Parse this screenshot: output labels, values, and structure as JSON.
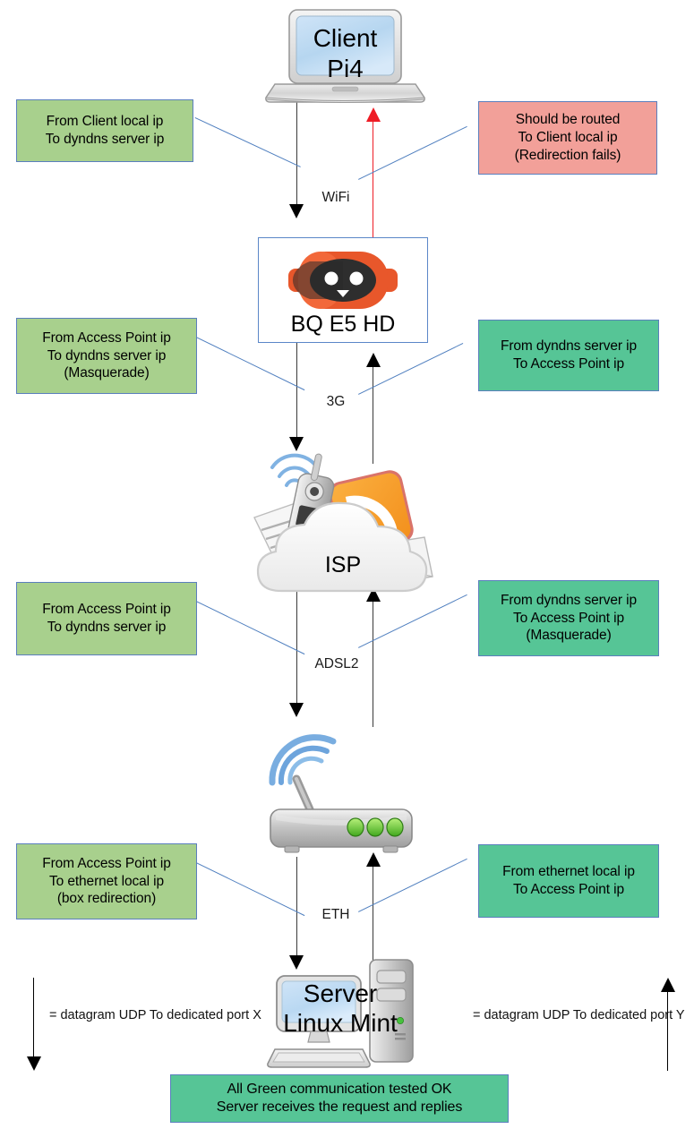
{
  "diagram": {
    "title": "Network datagram routing path diagram",
    "colors": {
      "green_left": "#a8d08d",
      "green_right": "#56c596",
      "red": "#f2a099",
      "box_border": "#5b7fbd",
      "arrow_dark": "#000000",
      "arrow_red": "#ee1c25",
      "robot_orange": "#e8572b"
    }
  },
  "nodes": [
    {
      "id": "client",
      "label_line1": "Client",
      "label_line2": "Pi4",
      "icon": "laptop-icon"
    },
    {
      "id": "bq",
      "label_line1": "BQ E5 HD",
      "label_line2": "",
      "icon": "robot-icon"
    },
    {
      "id": "isp",
      "label_line1": "ISP",
      "label_line2": "",
      "icon": "cloud-isp-icon"
    },
    {
      "id": "router",
      "label_line1": "",
      "label_line2": "",
      "icon": "wifi-router-icon"
    },
    {
      "id": "server",
      "label_line1": "Server",
      "label_line2": "Linux Mint",
      "icon": "desktop-computer-icon"
    }
  ],
  "links": [
    {
      "id": "wifi",
      "label": "WiFi"
    },
    {
      "id": "3g",
      "label": "3G"
    },
    {
      "id": "adsl2",
      "label": "ADSL2"
    },
    {
      "id": "eth",
      "label": "ETH"
    }
  ],
  "notes_left": [
    {
      "id": "note-client-out",
      "color": "green_left",
      "lines": [
        "From Client local ip",
        "To dyndns server ip"
      ]
    },
    {
      "id": "note-bq-out",
      "color": "green_left",
      "lines": [
        "From Access Point ip",
        "To dyndns server ip",
        "(Masquerade)"
      ]
    },
    {
      "id": "note-isp-out",
      "color": "green_left",
      "lines": [
        "From Access Point ip",
        "To dyndns server ip"
      ]
    },
    {
      "id": "note-router-out",
      "color": "green_left",
      "lines": [
        "From Access Point ip",
        "To ethernet local ip",
        "(box redirection)"
      ]
    }
  ],
  "notes_right": [
    {
      "id": "note-client-in",
      "color": "red",
      "lines": [
        "Should be routed",
        "To Client local ip",
        "(Redirection fails)"
      ]
    },
    {
      "id": "note-bq-in",
      "color": "green_right",
      "lines": [
        "From dyndns server ip",
        "To Access Point ip"
      ]
    },
    {
      "id": "note-isp-in",
      "color": "green_right",
      "lines": [
        "From dyndns server ip",
        "To Access Point ip",
        "(Masquerade)"
      ]
    },
    {
      "id": "note-router-in",
      "color": "green_right",
      "lines": [
        "From ethernet local ip",
        "To Access Point ip"
      ]
    }
  ],
  "legend": {
    "left": {
      "lines": [
        "= datagram UDP",
        "To dedicated port X"
      ],
      "direction": "down"
    },
    "right": {
      "lines": [
        "= datagram UDP",
        "To dedicated port Y"
      ],
      "direction": "up"
    }
  },
  "footer_note": {
    "color": "green_right",
    "lines": [
      "All Green communication tested OK",
      "Server receives the request and replies"
    ]
  }
}
